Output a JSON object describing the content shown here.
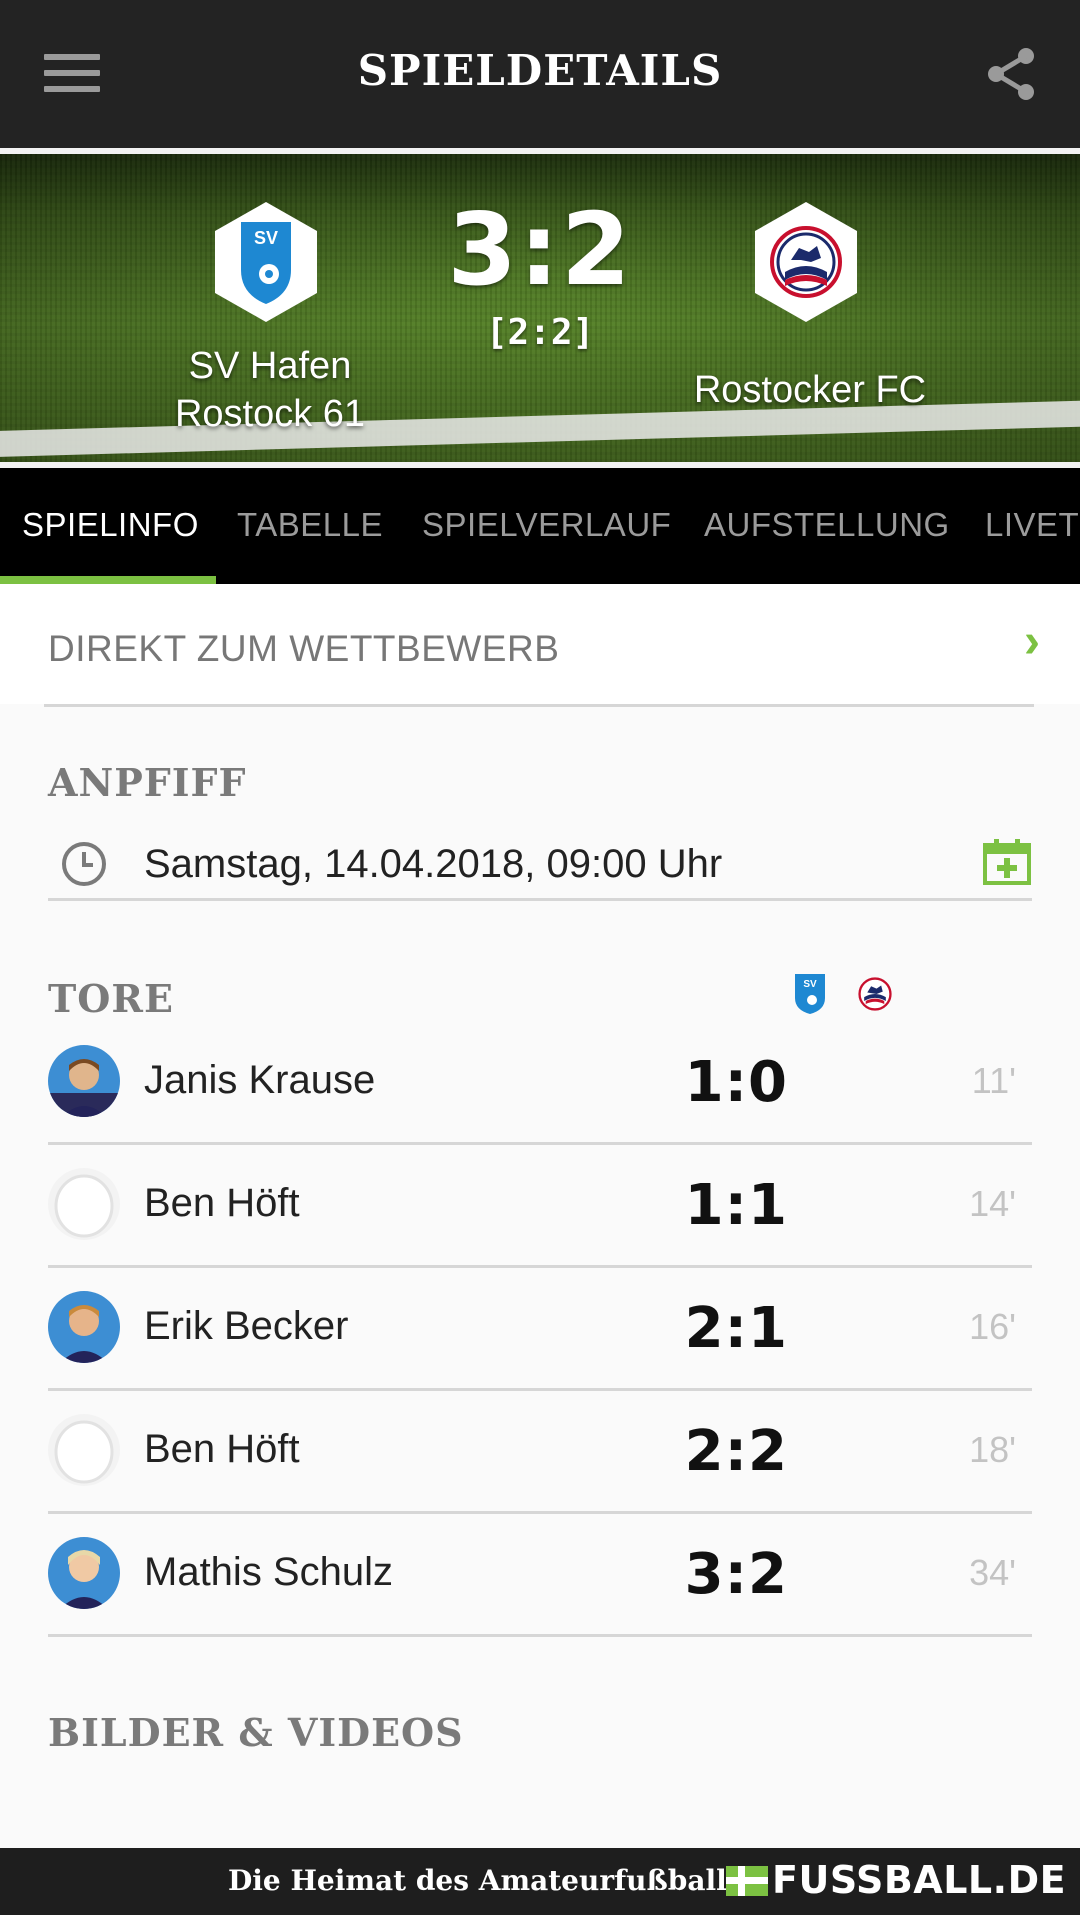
{
  "appbar": {
    "title": "SPIELDETAILS"
  },
  "match": {
    "home_team": "SV Hafen\nRostock 61",
    "away_team": "Rostocker FC",
    "score": "3:2",
    "halftime": "[2:2]"
  },
  "tabs": [
    {
      "label": "SPIELINFO",
      "active": true
    },
    {
      "label": "TABELLE",
      "active": false
    },
    {
      "label": "SPIELVERLAUF",
      "active": false
    },
    {
      "label": "AUFSTELLUNG",
      "active": false
    },
    {
      "label": "LIVET",
      "active": false
    }
  ],
  "competition_link": {
    "label": "DIREKT ZUM WETTBEWERB"
  },
  "kickoff": {
    "heading": "ANPFIFF",
    "datetime": "Samstag, 14.04.2018, 09:00 Uhr"
  },
  "goals": {
    "heading": "TORE",
    "items": [
      {
        "player": "Janis Krause",
        "score": "1:0",
        "minute": "11'",
        "avatar": "photo"
      },
      {
        "player": "Ben Höft",
        "score": "1:1",
        "minute": "14'",
        "avatar": "placeholder"
      },
      {
        "player": "Erik Becker",
        "score": "2:1",
        "minute": "16'",
        "avatar": "photo"
      },
      {
        "player": "Ben Höft",
        "score": "2:2",
        "minute": "18'",
        "avatar": "placeholder"
      },
      {
        "player": "Mathis Schulz",
        "score": "3:2",
        "minute": "34'",
        "avatar": "photo"
      }
    ]
  },
  "media": {
    "heading": "BILDER & VIDEOS"
  },
  "footer": {
    "slogan": "Die Heimat des Amateurfußballs",
    "brand": "FUSSBALL.DE"
  },
  "colors": {
    "accent": "#7cc142",
    "appbar": "#232323",
    "tabbar": "#000000",
    "home_blue": "#1e88d2",
    "away_red": "#c8102e"
  },
  "icons": [
    "menu-icon",
    "share-icon",
    "clock-icon",
    "calendar-add-icon",
    "chevron-right-icon"
  ]
}
